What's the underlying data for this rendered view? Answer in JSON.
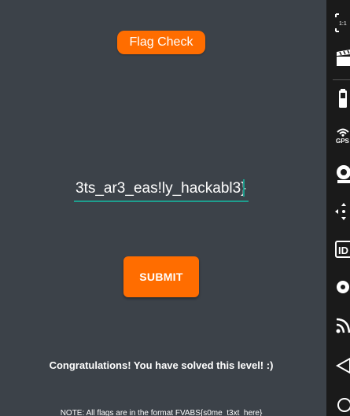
{
  "app": {
    "title_button_label": "Flag Check",
    "flag_input_value": "3ts_ar3_eas!ly_hackabl3}",
    "submit_label": "SUBMIT",
    "success_message": "Congratulations! You have solved this level! :)",
    "note_text": "NOTE: All flags are in the format FVABS{s0me_t3xt_here}"
  },
  "sidebar": {
    "icons": [
      "fullscreen-icon",
      "clapperboard-icon",
      "battery-icon",
      "gps-icon",
      "camera-icon",
      "move-icon",
      "id-icon",
      "record-icon",
      "rss-icon",
      "back-icon",
      "home-icon"
    ],
    "gps_label": "GPS",
    "id_label": "ID",
    "ratio_label": "1:1"
  },
  "colors": {
    "background": "#3c4249",
    "accent": "#ff6d00",
    "underline": "#1e9e8e",
    "sidebar": "#1a1a1a"
  }
}
